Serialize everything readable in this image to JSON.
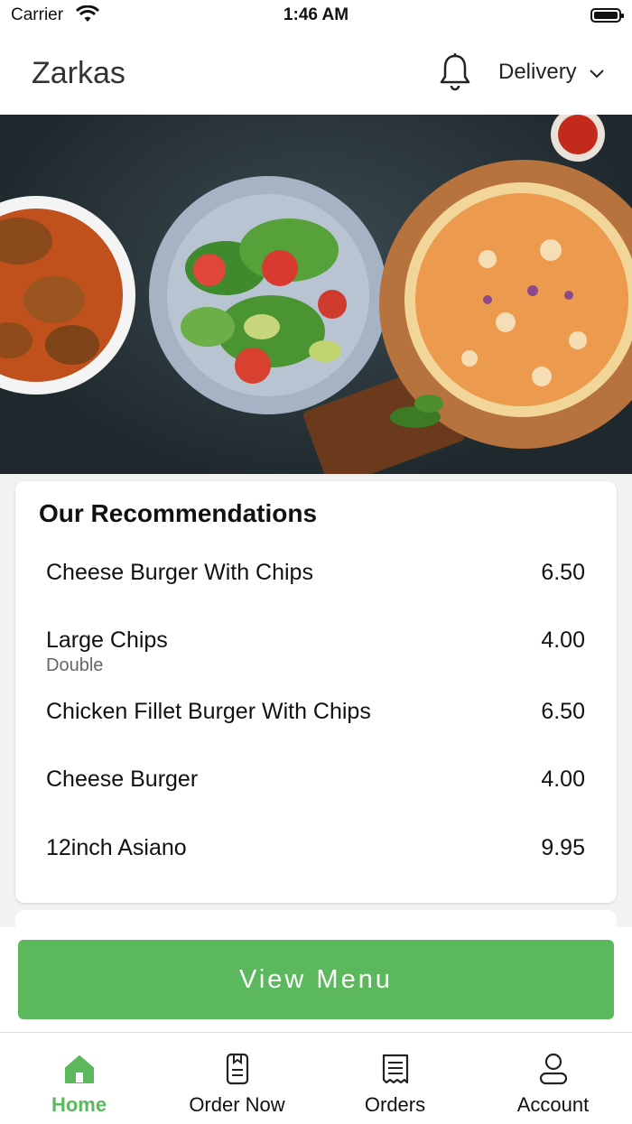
{
  "status_bar": {
    "carrier": "Carrier",
    "time": "1:46 AM"
  },
  "header": {
    "title": "Zarkas",
    "mode": "Delivery",
    "bell_icon": "bell-icon",
    "chevron_icon": "chevron-down-icon"
  },
  "recommendations": {
    "title": "Our Recommendations",
    "items": [
      {
        "name": "Cheese Burger With Chips",
        "sub": "",
        "price": "6.50"
      },
      {
        "name": "Large Chips",
        "sub": "Double",
        "price": "4.00"
      },
      {
        "name": "Chicken Fillet Burger With Chips",
        "sub": "",
        "price": "6.50"
      },
      {
        "name": "Cheese Burger",
        "sub": "",
        "price": "4.00"
      },
      {
        "name": "12inch Asiano",
        "sub": "",
        "price": "9.95"
      }
    ]
  },
  "view_menu": {
    "label": "View Menu"
  },
  "tabs": [
    {
      "label": "Home",
      "icon": "home-icon",
      "active": true
    },
    {
      "label": "Order Now",
      "icon": "order-icon",
      "active": false
    },
    {
      "label": "Orders",
      "icon": "receipt-icon",
      "active": false
    },
    {
      "label": "Account",
      "icon": "account-icon",
      "active": false
    }
  ],
  "colors": {
    "accent": "#5cb85c"
  }
}
